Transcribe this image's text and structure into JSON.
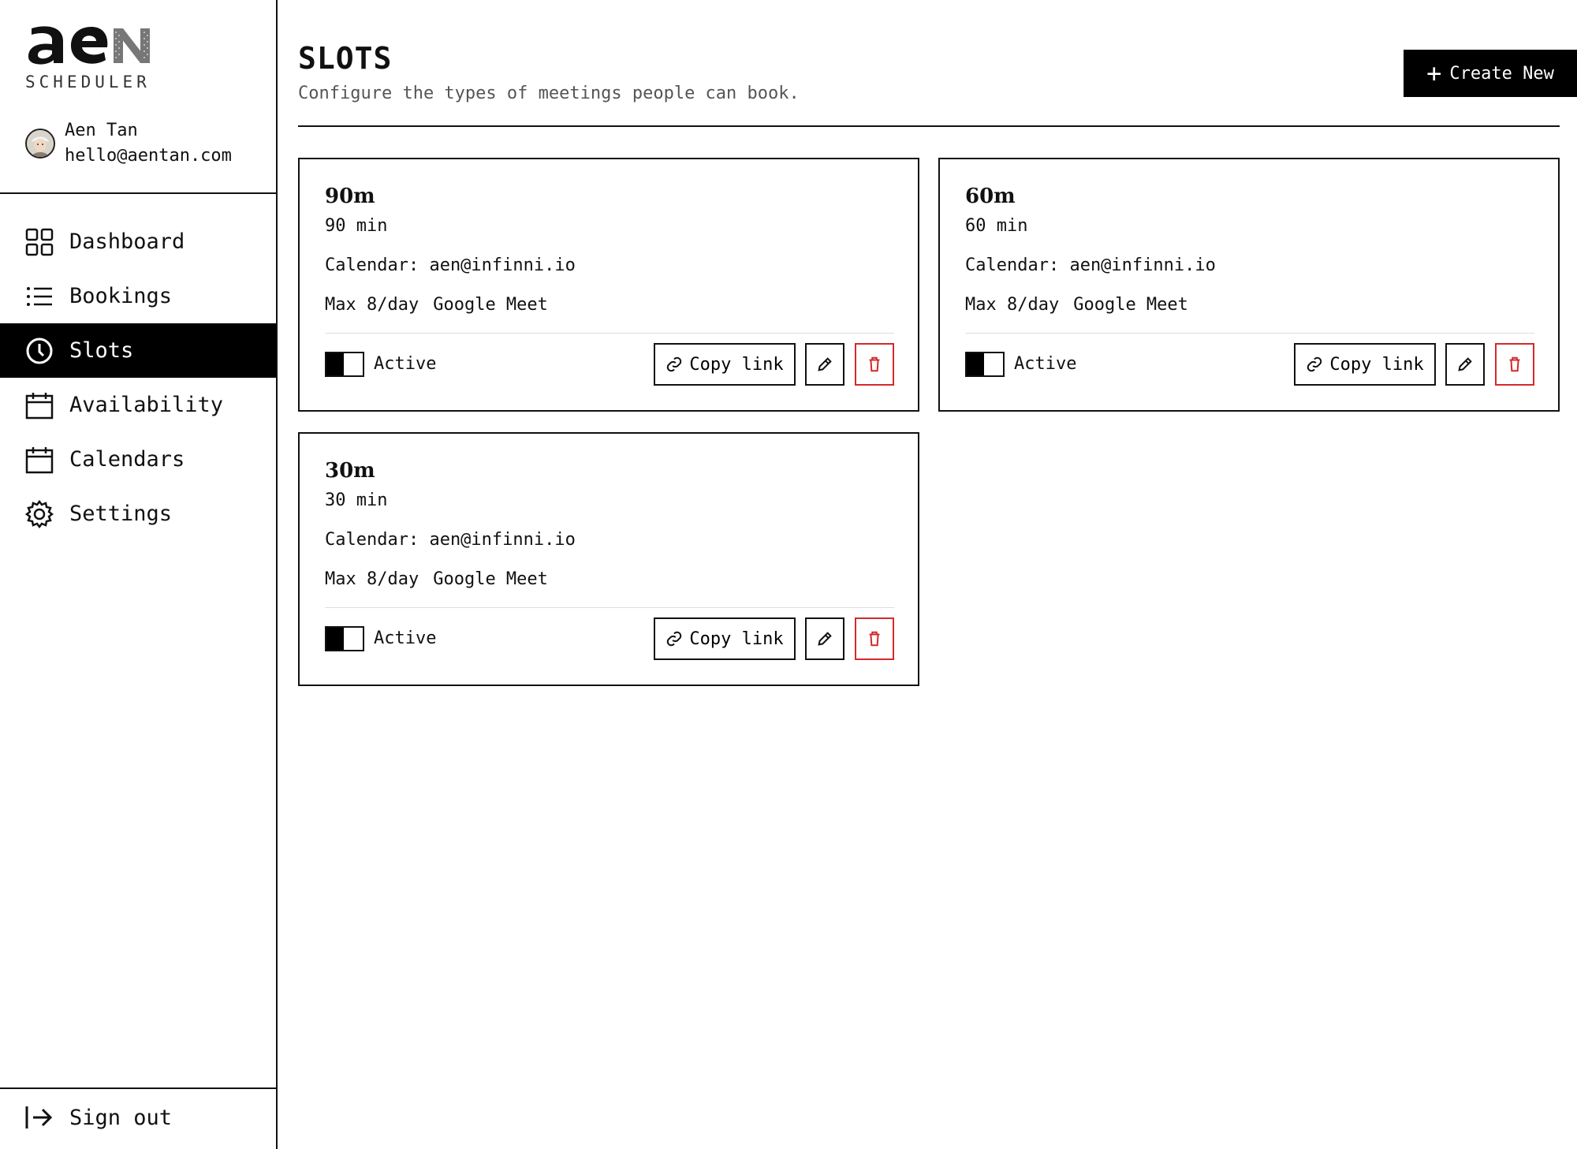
{
  "brand": {
    "logo_text": "aen",
    "subtitle": "SCHEDULER"
  },
  "user": {
    "name": "Aen Tan",
    "email": "hello@aentan.com"
  },
  "nav": {
    "items": [
      {
        "label": "Dashboard",
        "icon": "grid-icon",
        "active": false
      },
      {
        "label": "Bookings",
        "icon": "list-icon",
        "active": false
      },
      {
        "label": "Slots",
        "icon": "clock-icon",
        "active": true
      },
      {
        "label": "Availability",
        "icon": "calendar-icon",
        "active": false
      },
      {
        "label": "Calendars",
        "icon": "calendar-icon",
        "active": false
      },
      {
        "label": "Settings",
        "icon": "gear-icon",
        "active": false
      }
    ],
    "sign_out": "Sign out"
  },
  "header": {
    "title": "SLOTS",
    "subtitle": "Configure the types of meetings people can book.",
    "create_label": "Create New"
  },
  "slots": [
    {
      "title": "90m",
      "duration": "90 min",
      "calendar": "Calendar: aen@infinni.io",
      "max": "Max 8/day",
      "location": "Google Meet",
      "status": "Active",
      "copy_label": "Copy link"
    },
    {
      "title": "60m",
      "duration": "60 min",
      "calendar": "Calendar: aen@infinni.io",
      "max": "Max 8/day",
      "location": "Google Meet",
      "status": "Active",
      "copy_label": "Copy link"
    },
    {
      "title": "30m",
      "duration": "30 min",
      "calendar": "Calendar: aen@infinni.io",
      "max": "Max 8/day",
      "location": "Google Meet",
      "status": "Active",
      "copy_label": "Copy link"
    }
  ],
  "colors": {
    "accent": "#000000",
    "danger": "#d42a2a",
    "border": "#111111"
  }
}
